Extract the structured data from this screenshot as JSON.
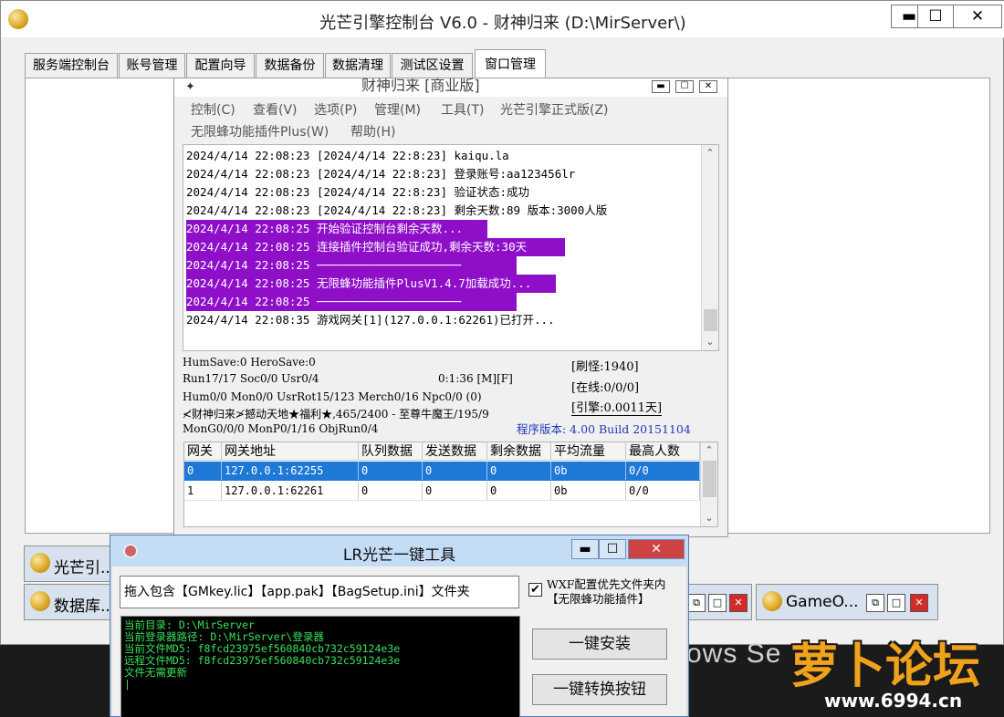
{
  "window": {
    "title": "光芒引擎控制台 V6.0 - 财神归来 (D:\\MirServer\\)",
    "min_glyph": "▬",
    "max_glyph": "☐",
    "close_glyph": "✕"
  },
  "tabs": [
    {
      "label": "服务端控制台"
    },
    {
      "label": "账号管理"
    },
    {
      "label": "配置向导"
    },
    {
      "label": "数据备份"
    },
    {
      "label": "数据清理"
    },
    {
      "label": "测试区设置"
    },
    {
      "label": "窗口管理",
      "active": true
    }
  ],
  "inner_window": {
    "title": "财神归来 [商业版]",
    "menu_row1": [
      "控制(C)",
      "查看(V)",
      "选项(P)",
      "管理(M)",
      "工具(T)",
      "光芒引擎正式版(Z)"
    ],
    "menu_row2": [
      "无限蜂功能插件Plus(W)",
      "帮助(H)"
    ],
    "log": [
      {
        "text": "2024/4/14 22:08:23 [2024/4/14 22:8:23] kaiqu.la",
        "highlight": false
      },
      {
        "text": "2024/4/14 22:08:23 [2024/4/14 22:8:23] 登录账号:aa123456lr",
        "highlight": false
      },
      {
        "text": "2024/4/14 22:08:23 [2024/4/14 22:8:23] 验证状态:成功",
        "highlight": false
      },
      {
        "text": "2024/4/14 22:08:23 [2024/4/14 22:8:23] 剩余天数:89 版本:3000人版",
        "highlight": false
      },
      {
        "text": "2024/4/14 22:08:25 开始验证控制台剩余天数...",
        "highlight": true
      },
      {
        "text": "2024/4/14 22:08:25 连接插件控制台验证成功,剩余天数:30天",
        "highlight": true
      },
      {
        "text": "2024/4/14 22:08:25 ─────────────────────",
        "highlight": true
      },
      {
        "text": "2024/4/14 22:08:25 无限蜂功能插件PlusV1.4.7加载成功...",
        "highlight": true
      },
      {
        "text": "2024/4/14 22:08:25 ─────────────────────",
        "highlight": true
      },
      {
        "text": "2024/4/14 22:08:35 游戏网关[1](127.0.0.1:62261)已打开...",
        "highlight": false
      }
    ],
    "status": {
      "line1": "HumSave:0 HeroSave:0",
      "line2": "Run17/17 Soc0/0 Usr0/4",
      "timer": "0:1:36 [M][F]",
      "line3": "Hum0/0 Mon0/0 UsrRot15/123 Merch0/16 Npc0/0 (0)",
      "line4": "≮财神归来≯撼动天地★福利★,465/2400 - 至尊牛魔王/195/9",
      "line5": "MonG0/0/0 MonP0/1/16 ObjRun0/4",
      "refresh": "[刷怪:1940]",
      "online": "[在线:0/0/0]",
      "engine": "[引擎:0.0011天]",
      "version": "程序版本: 4.00 Build 20151104"
    },
    "gateway_table": {
      "headers": [
        "网关",
        "网关地址",
        "队列数据",
        "发送数据",
        "剩余数据",
        "平均流量",
        "最高人数"
      ],
      "rows": [
        [
          "0",
          "127.0.0.1:62255",
          "0",
          "0",
          "0",
          "0b",
          "0/0"
        ],
        [
          "1",
          "127.0.0.1:62261",
          "0",
          "0",
          "0",
          "0b",
          "0/0"
        ]
      ]
    }
  },
  "minimized": {
    "win1_label": "光芒引...",
    "win2_label": "数据库...",
    "win3_label": "GameO..."
  },
  "tool_window": {
    "title": "LR光芒一键工具",
    "drop_text": "拖入包含【GMkey.lic】【app.pak】【BagSetup.ini】文件夹",
    "wxf_checked": true,
    "wxf_label_line1": "WXF配置优先文件夹内",
    "wxf_label_line2": "【无限蜂功能插件】",
    "console": [
      "当前目录: D:\\MirServer",
      "当前登录器路径: D:\\MirServer\\登录器",
      "当前文件MD5: f8fcd23975ef560840cb732c59124e3e",
      "远程文件MD5: f8fcd23975ef560840cb732c59124e3e",
      "文件无需更新"
    ],
    "install_button": "一键安装",
    "convert_button": "一键转换按钮"
  },
  "desktop_text": "ows Se",
  "watermark": {
    "title": "萝卜论坛",
    "url": "www.6994.cn"
  }
}
